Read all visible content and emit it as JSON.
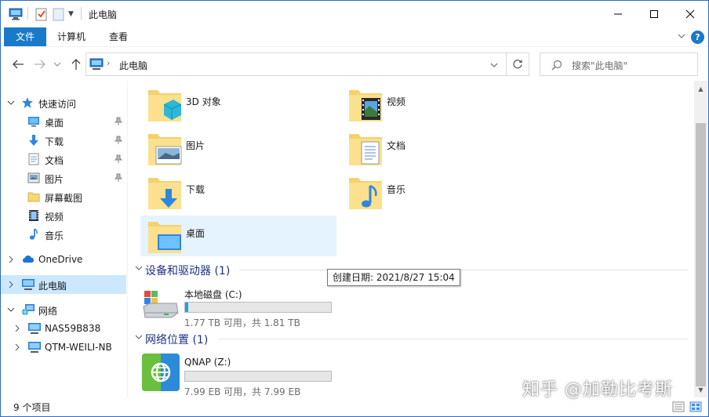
{
  "window": {
    "title": "此电脑"
  },
  "ribbon": {
    "tabs": [
      "文件",
      "计算机",
      "查看"
    ]
  },
  "address": {
    "path": "此电脑",
    "search_placeholder": "搜索\"此电脑\""
  },
  "nav": {
    "quick_access": "快速访问",
    "quick_items": [
      "桌面",
      "下载",
      "文档",
      "图片",
      "屏幕截图",
      "视频",
      "音乐"
    ],
    "onedrive": "OneDrive",
    "this_pc": "此电脑",
    "network": "网络",
    "network_items": [
      "NAS59B838",
      "QTM-WEILI-NB"
    ]
  },
  "folders": [
    {
      "name": "3D 对象",
      "icon": "3d-objects-folder-icon"
    },
    {
      "name": "视频",
      "icon": "videos-folder-icon"
    },
    {
      "name": "图片",
      "icon": "pictures-folder-icon"
    },
    {
      "name": "文档",
      "icon": "documents-folder-icon"
    },
    {
      "name": "下载",
      "icon": "downloads-folder-icon"
    },
    {
      "name": "音乐",
      "icon": "music-folder-icon"
    },
    {
      "name": "桌面",
      "icon": "desktop-folder-icon"
    }
  ],
  "groups": {
    "devices": "设备和驱动器 (1)",
    "network_locations": "网络位置 (1)"
  },
  "drives": [
    {
      "name": "本地磁盘 (C:)",
      "detail": "1.77 TB 可用，共 1.81 TB",
      "used_fraction": 0.02
    },
    {
      "name": "QNAP (Z:)",
      "detail": "7.99 EB 可用，共 7.99 EB",
      "used_fraction": 0.0
    }
  ],
  "tooltip": "创建日期: 2021/8/27 15:04",
  "status": {
    "count": "9 个项目"
  },
  "watermark": "知乎 @加勒比考斯",
  "colors": {
    "accent": "#1979ca",
    "selected": "#cce8ff",
    "drive_bar": "#26a0da"
  }
}
